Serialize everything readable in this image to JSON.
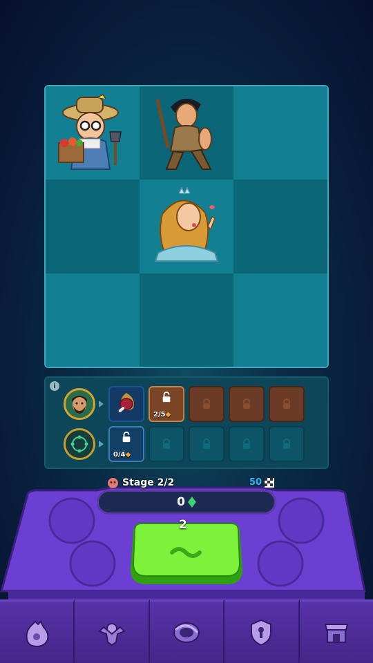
{
  "board": {
    "cells": [
      {
        "hero": "farmer"
      },
      {
        "hero": "warrior"
      },
      {
        "hero": null
      },
      {
        "hero": null
      },
      {
        "hero": "princess"
      },
      {
        "hero": null
      },
      {
        "hero": null
      },
      {
        "hero": null
      },
      {
        "hero": null
      }
    ]
  },
  "slots": {
    "row1": {
      "counter_value": "2/5"
    },
    "row2": {
      "counter_value": "0/4"
    }
  },
  "stage": {
    "label": "Stage 2/2",
    "waves_value": "50"
  },
  "resource": {
    "value": "0",
    "icon": "green-gem-icon"
  },
  "roll_button": {
    "cost": "2"
  },
  "nav": {
    "items": [
      "bag-icon",
      "heroes-icon",
      "portal-icon",
      "shield-key-icon",
      "shop-icon"
    ]
  },
  "colors": {
    "accent_purple": "#5b3aa8",
    "button_green": "#6be02f",
    "board_teal": "#127f92"
  }
}
